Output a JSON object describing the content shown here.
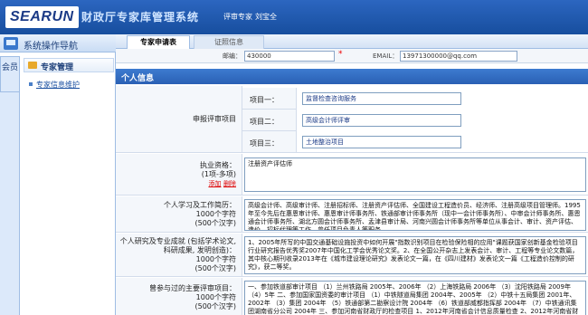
{
  "header": {
    "logo_text": "SEARUN",
    "system_title": "财政厅专家库管理系统",
    "user_role": "评审专家",
    "user_name": "刘宝全"
  },
  "nav": {
    "title": "系统操作导航",
    "vtab_label": "会员",
    "group_label": "专家管理",
    "items": [
      {
        "label": "专家信息维护"
      }
    ]
  },
  "tabs": [
    {
      "label": "专家申请表",
      "active": true
    },
    {
      "label": "证照信息",
      "active": false
    }
  ],
  "form": {
    "zip_label": "邮编：",
    "zip_value": "430000",
    "email_label": "EMAIL：",
    "email_value": "13971300000@qq.com",
    "section_personal": "个人信息",
    "apply_items_label": "申报评审项目",
    "apply_items": [
      {
        "label": "项目一：",
        "value": "监督检查咨询服务"
      },
      {
        "label": "项目二：",
        "value": "高级会计师评审"
      },
      {
        "label": "项目三：",
        "value": "土地整治项目"
      }
    ],
    "qualification_label": "执业资格：",
    "qualification_hint": "(1项-多项)",
    "add_link": "添加",
    "delete_link": "删除",
    "qualification_value": "注册资产评估师",
    "study_label": "个人学习及工作简历：",
    "study_limit_a": "1000个字符",
    "study_limit_b": "(500个汉字)",
    "study_value": "高级会计师、高级审计师、注册招标师、注册资产评估师、全国建设工程造价员、经济师、注册高级项目管理师。1995年至今先后在惠恩审计师、惠恩审计师事务所、铁通部审计师事务所（现中一会计师事务所）、中审会计师事务所、惠恩通会计师事务所、湖北方圆会计师事务所、孟津县审计局、河南兴圆会计师事务所等单位从事会计、审计、资产评估、造价、招标代理等工作，曾任项目负责人等职务。",
    "research_label": "个人研究及专业成就 (包括学术论文, 科研成果, 发明创造)：",
    "research_limit_a": "1000个字符",
    "research_limit_b": "(500个汉字)",
    "research_value": "1、2005年所写的中国交通基础设施投资中如何开展\"指数识别项目在检验保险相的应用\"课题获国家创新基金检验项目行业研究报告优秀奖2007年中国化工学会优秀论文奖。2、在全国公开杂志上发表会计、审计、工程等专业论文数篇，其中核心期刊收录2013年在《城市建设理论研究》发表论文一篇，在《四川建材》发表论文一篇《工程造价控制的研究》，获二等奖。",
    "projects_label": "曾参与过的主要评审项目：",
    "projects_limit_a": "1000个字符",
    "projects_limit_b": "(500个汉字)",
    "projects_value": "一、参加铁道部审计项目  （1）兰州铁路局 2005年、2006年 （2）上海铁路局 2006年 （3）沈阳铁路局 2009年 （4）5年 二、参加国家国资委的审计项目 （1）中铁隧道局集团 2004年、2005年 （2）中铁十五局集团 2001年、2002年 （3）集团 2004年 （5）铁通部第二勘察设计院 2004年 （6）铁道部威都指挥部 2004年 （7）中铁通讯集团湖南省分公司 2004年 三、参加河南省财政厅的检查项目 1、2012年河南省会计信息质量检查 2、2012年河南省财政专项资金检查"
  }
}
